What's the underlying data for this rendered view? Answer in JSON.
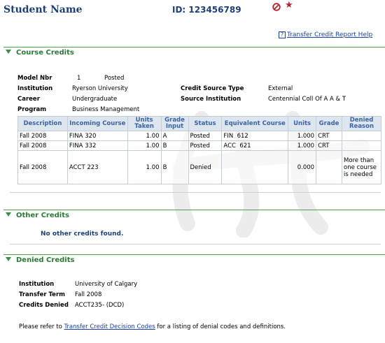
{
  "header": {
    "student_name": "Student Name",
    "student_id": "ID: 123456789",
    "icons": [
      "no-entry-icon",
      "star-icon"
    ],
    "star_glyph": "★"
  },
  "help_link": {
    "icon_glyph": "?",
    "label": "Transfer Credit Report Help"
  },
  "course_credits": {
    "title": "Course Credits",
    "fields": {
      "model_nbr_label": "Model Nbr",
      "model_nbr": "1",
      "model_status": "Posted",
      "institution_label": "Institution",
      "institution": "Ryerson University",
      "career_label": "Career",
      "career": "Undergraduate",
      "program_label": "Program",
      "program": "Business Management",
      "credit_source_type_label": "Credit Source Type",
      "credit_source_type": "External",
      "source_institution_label": "Source Institution",
      "source_institution": "Centennial Coll Of A A & T"
    },
    "table": {
      "headers": [
        "Description",
        "Incoming Course",
        "Units Taken",
        "Grade Input",
        "Status",
        "Equivalent Course",
        "Units",
        "Grade",
        "Denied Reason"
      ],
      "rows": [
        [
          "Fall 2008",
          "FINA 320",
          "1.00",
          "A",
          "Posted",
          "FIN  612",
          "1.000",
          "CRT",
          ""
        ],
        [
          "Fall 2008",
          "FINA 332",
          "1.00",
          "B",
          "Posted",
          "ACC  621",
          "1.000",
          "CRT",
          ""
        ],
        [
          "Fall 2008",
          "ACCT 223",
          "1.00",
          "B",
          "Denied",
          "",
          "0.000",
          "",
          "More than one course is needed"
        ]
      ]
    }
  },
  "other_credits": {
    "title": "Other Credits",
    "message": "No other credits found."
  },
  "denied_credits": {
    "title": "Denied Credits",
    "institution_label": "Institution",
    "institution": "University of Calgary",
    "transfer_term_label": "Transfer Term",
    "transfer_term": "Fall 2008",
    "credits_denied_label": "Credits Denied",
    "credits_denied": "ACCT235- (DCD)"
  },
  "footer": {
    "prefix": "Please refer to ",
    "link": "Transfer Credit Decision Codes",
    "suffix": " for a listing of denial codes and definitions."
  },
  "colors": {
    "section_green": "#2c7a37",
    "heading_blue": "#1d3f7a",
    "link_blue": "#1a3fb5",
    "table_header_bg": "#dde5ef",
    "table_header_text": "#3b64a8",
    "icon_red": "#b4232b"
  }
}
